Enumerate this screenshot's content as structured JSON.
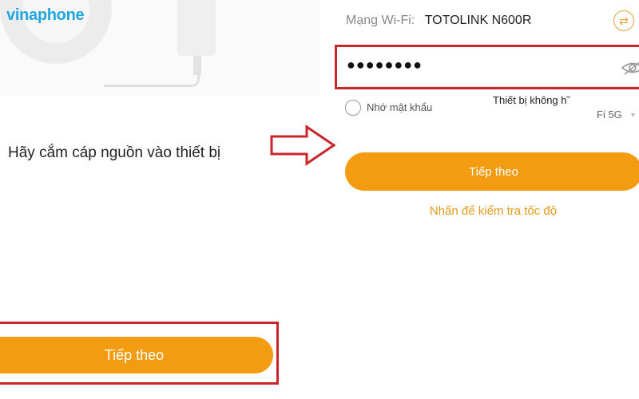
{
  "brand": {
    "logo_text": "vinaphone"
  },
  "left_screen": {
    "instruction": "Hãy cắm cáp nguồn vào thiết bị",
    "next_button_label": "Tiếp theo"
  },
  "right_screen": {
    "wifi_label": "Mạng Wi-Fi:",
    "wifi_name": "TOTOLINK N600R",
    "password_value": "●●●●●●●●",
    "remember_password_label": "Nhớ mật khẩu",
    "device_note": "Thiết bị không h˜",
    "device_note_2": "Fi 5G",
    "next_button_label": "Tiếp theo",
    "speed_test_link": "Nhấn để kiểm tra tốc độ"
  },
  "colors": {
    "accent": "#f39c12",
    "highlight": "#c9262c",
    "brand": "#21a6e0"
  },
  "icons": [
    "switch-network-icon",
    "eye-icon",
    "arrow-right-icon",
    "chevron-down-icon"
  ]
}
